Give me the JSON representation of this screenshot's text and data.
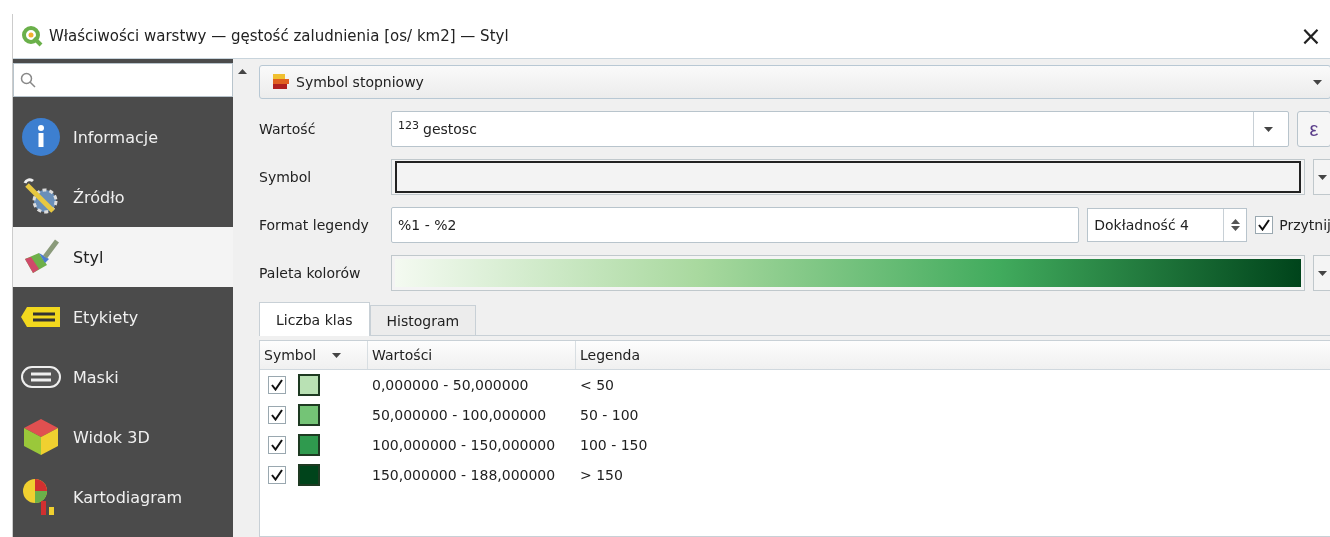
{
  "window": {
    "title": "Właściwości warstwy — gęstość zaludnienia [os/ km2] — Styl",
    "close": "×"
  },
  "sidebar": {
    "items": [
      {
        "label": "Informacje",
        "selected": false
      },
      {
        "label": "Źródło",
        "selected": false
      },
      {
        "label": "Styl",
        "selected": true
      },
      {
        "label": "Etykiety",
        "selected": false
      },
      {
        "label": "Maski",
        "selected": false
      },
      {
        "label": "Widok 3D",
        "selected": false
      },
      {
        "label": "Kartodiagram",
        "selected": false
      }
    ]
  },
  "renderer": {
    "value": "Symbol stopniowy"
  },
  "form": {
    "value_label": "Wartość",
    "value_type": "123",
    "value_field": "gestosc",
    "expression_button": "ε",
    "symbol_label": "Symbol",
    "legend_format_label": "Format legendy",
    "legend_format": "%1 - %2",
    "precision": "Dokładność 4",
    "trim_label": "Przytnij",
    "trim_checked": true,
    "palette_label": "Paleta kolorów"
  },
  "tabs": [
    {
      "label": "Liczba klas",
      "selected": true
    },
    {
      "label": "Histogram",
      "selected": false
    }
  ],
  "table": {
    "columns": [
      "Symbol",
      "Wartości",
      "Legenda"
    ],
    "rows": [
      {
        "checked": true,
        "color": "#b9e1b4",
        "values": "0,000000 - 50,000000",
        "legend": "< 50"
      },
      {
        "checked": true,
        "color": "#74c476",
        "values": "50,000000 - 100,000000",
        "legend": "50 - 100"
      },
      {
        "checked": true,
        "color": "#2f9a4e",
        "values": "100,000000 - 150,000000",
        "legend": "100 - 150"
      },
      {
        "checked": true,
        "color": "#00441b",
        "values": "150,000000 - 188,000000",
        "legend": "> 150"
      }
    ]
  }
}
